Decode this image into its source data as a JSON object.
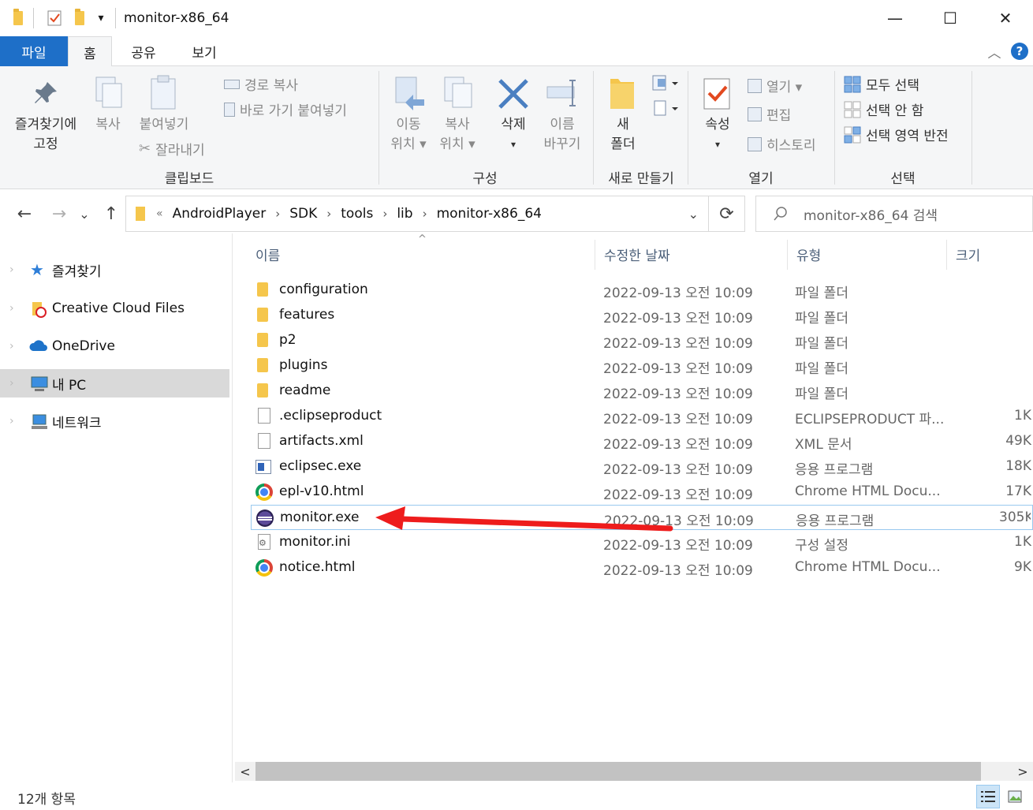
{
  "window": {
    "title": "monitor-x86_64",
    "minimize": "—",
    "maximize": "☐",
    "close": "✕",
    "qa_dropdown": "▾"
  },
  "tabs": {
    "file": "파일",
    "home": "홈",
    "share": "공유",
    "view": "보기",
    "collapse": "︿",
    "help": "?"
  },
  "ribbon": {
    "clipboard": {
      "pin_line1": "즐겨찾기에",
      "pin_line2": "고정",
      "copy": "복사",
      "paste": "붙여넣기",
      "copy_path": "경로 복사",
      "paste_shortcut": "바로 가기 붙여넣기",
      "cut": "잘라내기",
      "group": "클립보드"
    },
    "organize": {
      "move_line1": "이동",
      "move_line2": "위치 ▾",
      "copyto_line1": "복사",
      "copyto_line2": "위치 ▾",
      "delete_line1": "삭제",
      "delete_line2": "▾",
      "rename_line1": "이름",
      "rename_line2": "바꾸기",
      "group": "구성"
    },
    "new": {
      "folder_line1": "새",
      "folder_line2": "폴더",
      "group": "새로 만들기"
    },
    "open": {
      "props_line1": "속성",
      "props_line2": "▾",
      "open": "열기 ▾",
      "edit": "편집",
      "history": "히스토리",
      "group": "열기"
    },
    "select": {
      "all": "모두 선택",
      "none": "선택 안 함",
      "invert": "선택 영역 반전",
      "group": "선택"
    }
  },
  "nav": {
    "back": "←",
    "forward": "→",
    "recent": "⌄",
    "up": "↑",
    "breadcrumb": [
      "AndroidPlayer",
      "SDK",
      "tools",
      "lib",
      "monitor-x86_64"
    ],
    "overflow": "«",
    "dropdown": "⌄",
    "refresh": "⟳",
    "search_placeholder": "monitor-x86_64 검색"
  },
  "navpane": [
    {
      "label": "즐겨찾기",
      "icon": "star-icon"
    },
    {
      "label": "Creative Cloud Files",
      "icon": "creative-cloud-folder-icon"
    },
    {
      "label": "OneDrive",
      "icon": "cloud-icon"
    },
    {
      "label": "내 PC",
      "icon": "computer-icon",
      "selected": true
    },
    {
      "label": "네트워크",
      "icon": "network-icon"
    }
  ],
  "columns": {
    "name": "이름",
    "date": "수정한 날짜",
    "type": "유형",
    "size": "크기",
    "sort_arrow": "^"
  },
  "files": [
    {
      "name": "configuration",
      "date": "2022-09-13 오전 10:09",
      "type": "파일 폴더",
      "size": "",
      "icon": "folder-icon"
    },
    {
      "name": "features",
      "date": "2022-09-13 오전 10:09",
      "type": "파일 폴더",
      "size": "",
      "icon": "folder-icon"
    },
    {
      "name": "p2",
      "date": "2022-09-13 오전 10:09",
      "type": "파일 폴더",
      "size": "",
      "icon": "folder-icon"
    },
    {
      "name": "plugins",
      "date": "2022-09-13 오전 10:09",
      "type": "파일 폴더",
      "size": "",
      "icon": "folder-icon"
    },
    {
      "name": "readme",
      "date": "2022-09-13 오전 10:09",
      "type": "파일 폴더",
      "size": "",
      "icon": "folder-icon"
    },
    {
      "name": ".eclipseproduct",
      "date": "2022-09-13 오전 10:09",
      "type": "ECLIPSEPRODUCT 파...",
      "size": "1K",
      "icon": "file-icon"
    },
    {
      "name": "artifacts.xml",
      "date": "2022-09-13 오전 10:09",
      "type": "XML 문서",
      "size": "49K",
      "icon": "file-icon"
    },
    {
      "name": "eclipsec.exe",
      "date": "2022-09-13 오전 10:09",
      "type": "응용 프로그램",
      "size": "18K",
      "icon": "exe-icon"
    },
    {
      "name": "epl-v10.html",
      "date": "2022-09-13 오전 10:09",
      "type": "Chrome HTML Docu...",
      "size": "17K",
      "icon": "chrome-icon"
    },
    {
      "name": "monitor.exe",
      "date": "2022-09-13 오전 10:09",
      "type": "응용 프로그램",
      "size": "305K",
      "icon": "eclipse-icon",
      "highlighted": true
    },
    {
      "name": "monitor.ini",
      "date": "2022-09-13 오전 10:09",
      "type": "구성 설정",
      "size": "1K",
      "icon": "settings-file-icon"
    },
    {
      "name": "notice.html",
      "date": "2022-09-13 오전 10:09",
      "type": "Chrome HTML Docu...",
      "size": "9K",
      "icon": "chrome-icon"
    }
  ],
  "scroll": {
    "left": "<",
    "right": ">"
  },
  "status": {
    "count": "12개 항목"
  },
  "colors": {
    "accent": "#1e6fc8",
    "annotation_arrow": "#ee1c1c",
    "selection_border": "#99c9ef"
  }
}
